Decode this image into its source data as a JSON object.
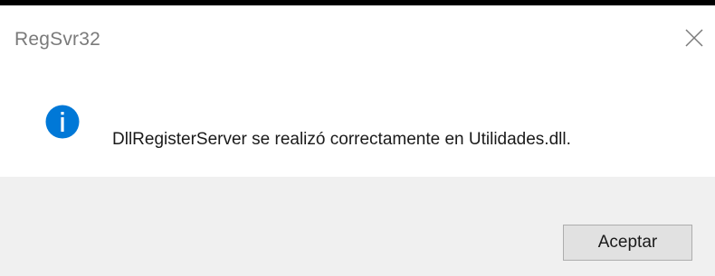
{
  "window": {
    "title": "RegSvr32",
    "close_icon": "close-icon"
  },
  "content": {
    "icon": "info-icon",
    "icon_color": "#0078d7",
    "message": "DllRegisterServer se realizó correctamente en Utilidades.dll."
  },
  "footer": {
    "ok_label": "Aceptar"
  }
}
